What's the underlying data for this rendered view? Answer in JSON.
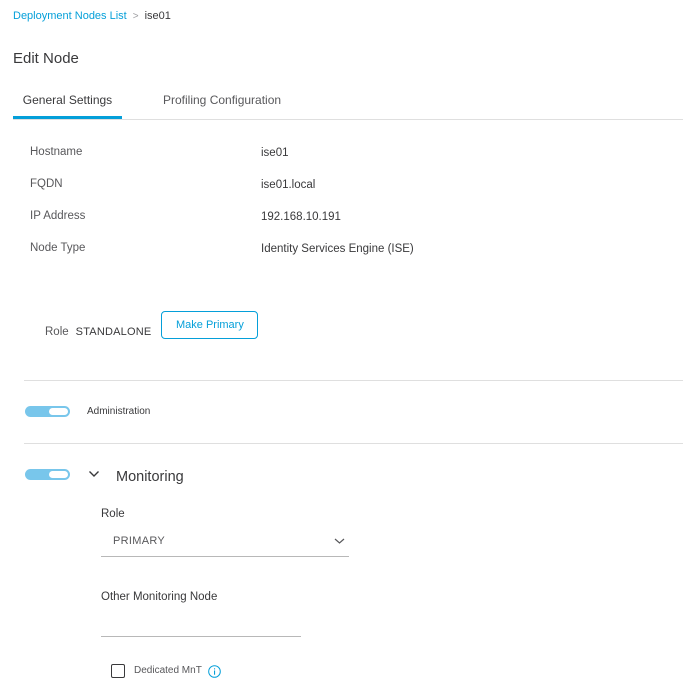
{
  "breadcrumb": {
    "parent_label": "Deployment Nodes List",
    "separator": ">",
    "current_label": "ise01"
  },
  "page_title": "Edit Node",
  "tabs": [
    {
      "label": "General Settings",
      "active": true
    },
    {
      "label": "Profiling Configuration",
      "active": false
    }
  ],
  "node_info": [
    {
      "label": "Hostname",
      "value": "ise01"
    },
    {
      "label": "FQDN",
      "value": "ise01.local"
    },
    {
      "label": "IP Address",
      "value": "192.168.10.191"
    },
    {
      "label": "Node Type",
      "value": "Identity Services Engine (ISE)"
    }
  ],
  "role": {
    "label": "Role",
    "value": "STANDALONE",
    "make_primary_label": "Make Primary"
  },
  "administration": {
    "label": "Administration",
    "enabled": true,
    "toggle_icon": "toggle-on-icon"
  },
  "monitoring": {
    "title": "Monitoring",
    "enabled": true,
    "expanded": true,
    "chevron_icon": "chevron-down-icon",
    "role_label": "Role",
    "role_value": "PRIMARY",
    "other_node_label": "Other Monitoring Node",
    "other_node_value": "",
    "dedicated_label": "Dedicated MnT",
    "dedicated_checked": false,
    "info_icon": "info-icon"
  },
  "colors": {
    "accent": "#049fd9",
    "toggle_on": "#78c6eb",
    "divider": "#dfdfdf",
    "text": "#39393b"
  }
}
